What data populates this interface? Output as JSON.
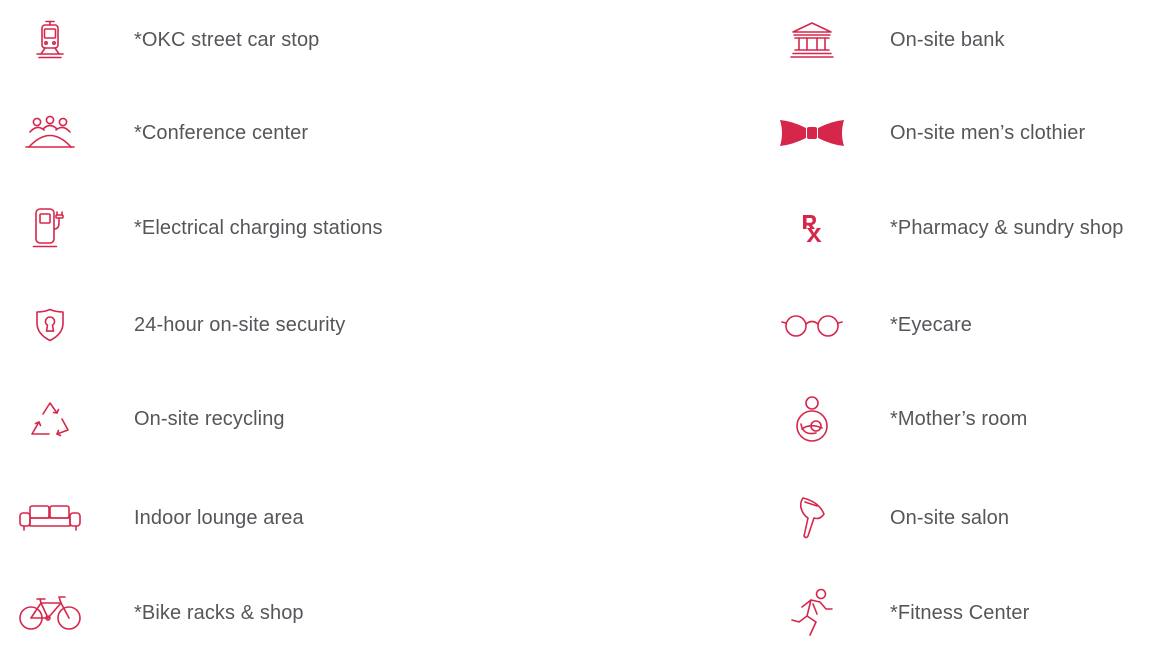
{
  "colors": {
    "accent": "#d6274b",
    "text": "#55565a",
    "background": "#ffffff"
  },
  "left_items": [
    {
      "label": "*OKC street car stop",
      "icon": "streetcar-icon"
    },
    {
      "label": "*Conference center",
      "icon": "conference-icon"
    },
    {
      "label": "*Electrical charging stations",
      "icon": "ev-charger-icon"
    },
    {
      "label": "24-hour on-site security",
      "icon": "security-shield-icon"
    },
    {
      "label": "On-site recycling",
      "icon": "recycling-icon"
    },
    {
      "label": "Indoor lounge area",
      "icon": "sofa-icon"
    },
    {
      "label": "*Bike racks & shop",
      "icon": "bicycle-icon"
    }
  ],
  "right_items": [
    {
      "label": "On-site bank",
      "icon": "bank-icon"
    },
    {
      "label": "On-site men’s clothier",
      "icon": "bow-tie-icon"
    },
    {
      "label": "*Pharmacy & sundry shop",
      "icon": "rx-icon"
    },
    {
      "label": "*Eyecare",
      "icon": "eyeglasses-icon"
    },
    {
      "label": "*Mother’s room",
      "icon": "mother-baby-icon"
    },
    {
      "label": "On-site salon",
      "icon": "hair-dryer-icon"
    },
    {
      "label": "*Fitness Center",
      "icon": "runner-icon"
    }
  ]
}
